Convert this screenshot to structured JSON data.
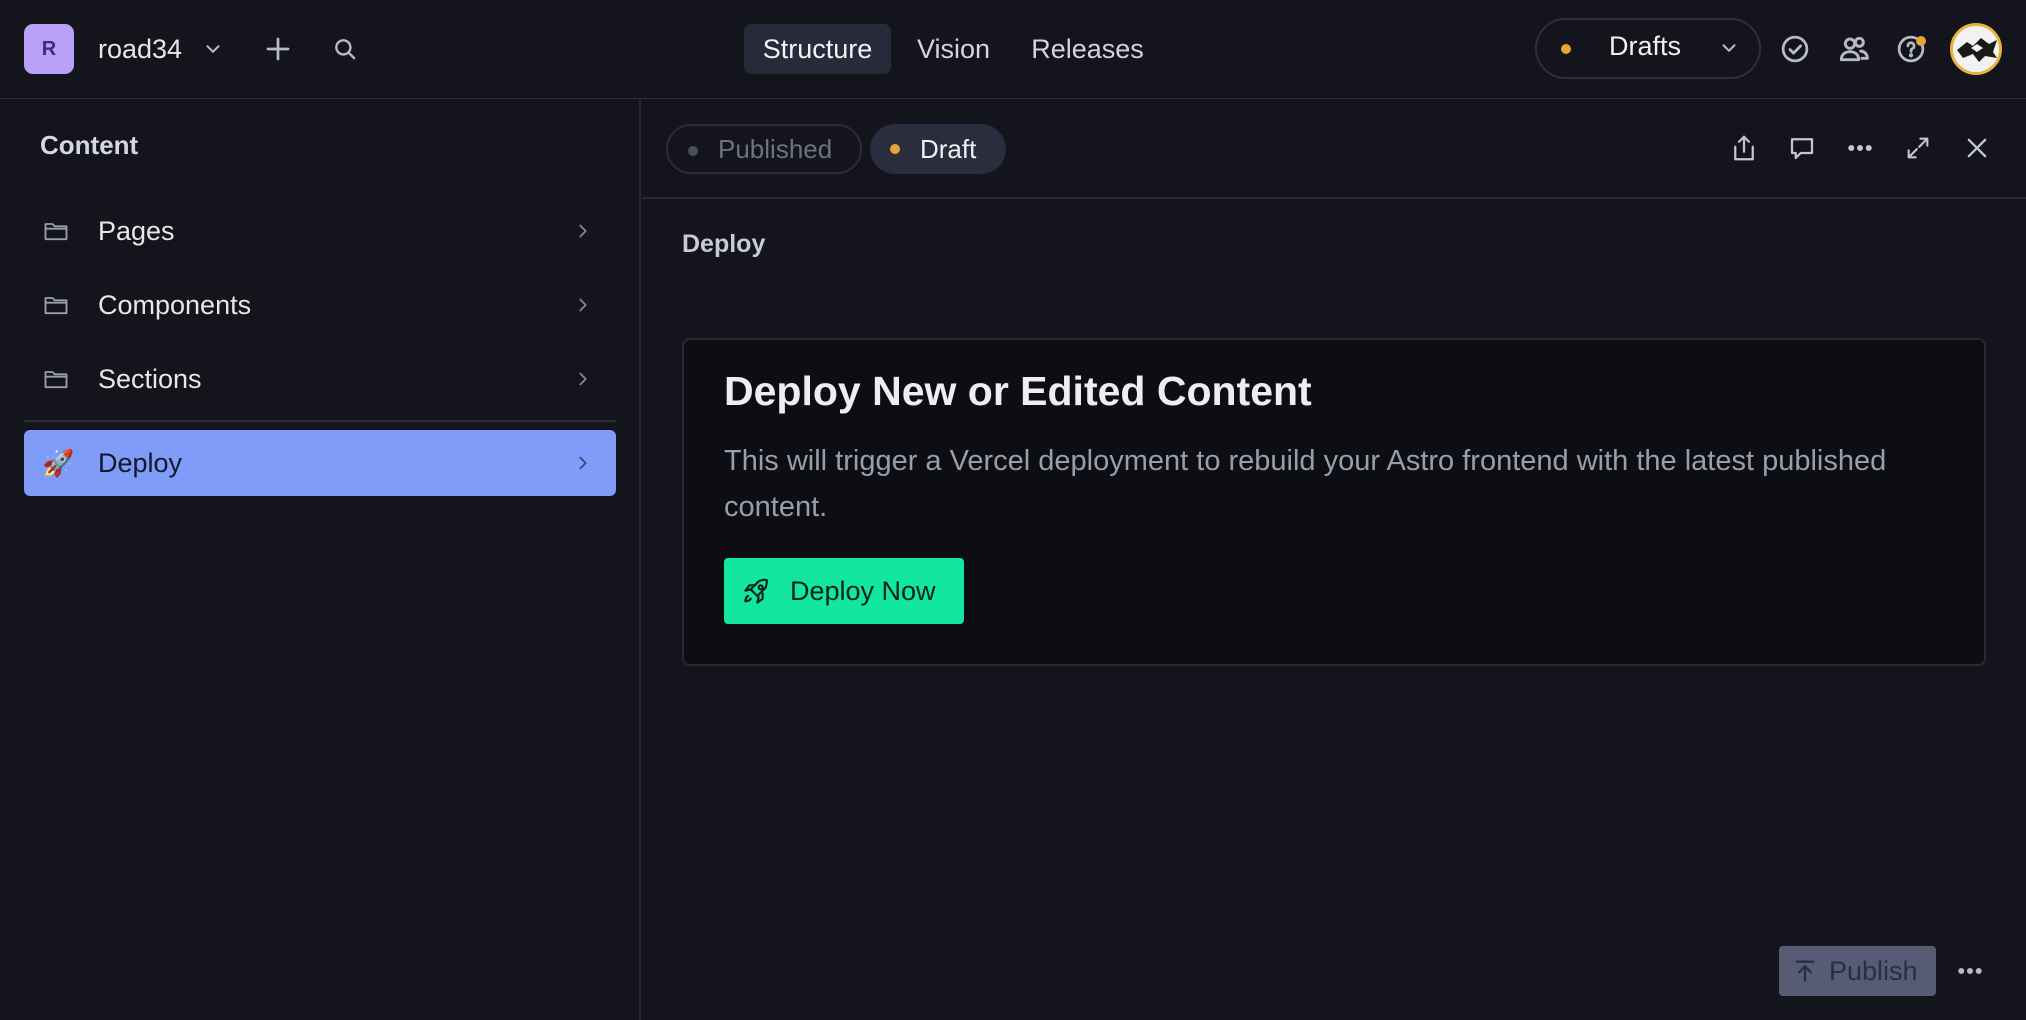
{
  "navbar": {
    "workspace_initial": "R",
    "workspace_name": "road34",
    "tabs": [
      {
        "label": "Structure",
        "active": true
      },
      {
        "label": "Vision",
        "active": false
      },
      {
        "label": "Releases",
        "active": false
      }
    ],
    "perspective": {
      "label": "Drafts",
      "dot_color": "#e8a33a"
    },
    "icons": [
      "plus-icon",
      "search-icon",
      "check-circle-icon",
      "users-icon",
      "help-icon"
    ]
  },
  "sidebar": {
    "title": "Content",
    "items": [
      {
        "label": "Pages",
        "icon": "folder-icon"
      },
      {
        "label": "Components",
        "icon": "folder-icon"
      },
      {
        "label": "Sections",
        "icon": "folder-icon"
      },
      {
        "label": "Deploy",
        "icon": "rocket-icon",
        "selected": true
      }
    ]
  },
  "document": {
    "status": {
      "published": "Published",
      "draft": "Draft"
    },
    "section_label": "Deploy",
    "card": {
      "title": "Deploy New or Edited Content",
      "description": "This will trigger a Vercel deployment to rebuild your Astro frontend with the latest published content.",
      "button_label": "Deploy Now"
    },
    "publish_label": "Publish"
  },
  "colors": {
    "background": "#13141c",
    "accent_selected": "#7e9cf8",
    "deploy_button": "#13e69e",
    "draft_dot": "#e8a33a"
  }
}
